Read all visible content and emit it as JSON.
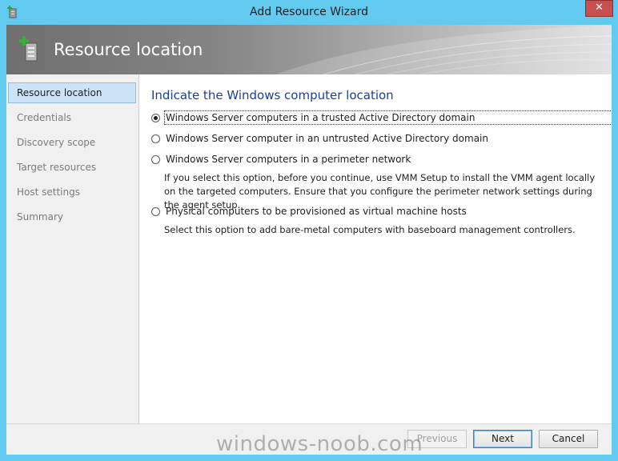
{
  "window": {
    "title": "Add Resource Wizard",
    "close_label": "✕"
  },
  "header": {
    "title": "Resource location"
  },
  "nav": {
    "items": [
      {
        "label": "Resource location",
        "active": true
      },
      {
        "label": "Credentials",
        "active": false
      },
      {
        "label": "Discovery scope",
        "active": false
      },
      {
        "label": "Target resources",
        "active": false
      },
      {
        "label": "Host settings",
        "active": false
      },
      {
        "label": "Summary",
        "active": false
      }
    ]
  },
  "main": {
    "heading": "Indicate the Windows computer location",
    "options": [
      {
        "label": "Windows Server computers in a trusted Active Directory domain",
        "selected": true,
        "description": ""
      },
      {
        "label": "Windows Server computer in an untrusted Active Directory domain",
        "selected": false,
        "description": ""
      },
      {
        "label": "Windows Server computers in a perimeter network",
        "selected": false,
        "description": "If you select this option, before you continue, use VMM Setup to install the VMM agent locally on the targeted computers. Ensure that you configure the perimeter network settings during the agent setup."
      },
      {
        "label": "Physical computers to be provisioned as virtual machine hosts",
        "selected": false,
        "description": "Select this option to add bare-metal computers with baseboard management controllers."
      }
    ]
  },
  "footer": {
    "previous_label": "Previous",
    "next_label": "Next",
    "cancel_label": "Cancel"
  },
  "watermark": "windows-noob.com",
  "colors": {
    "titlebar": "#62c9ef",
    "heading": "#1c3f94",
    "nav_active_bg": "#cde3f7",
    "close_button": "#c74f4f"
  }
}
